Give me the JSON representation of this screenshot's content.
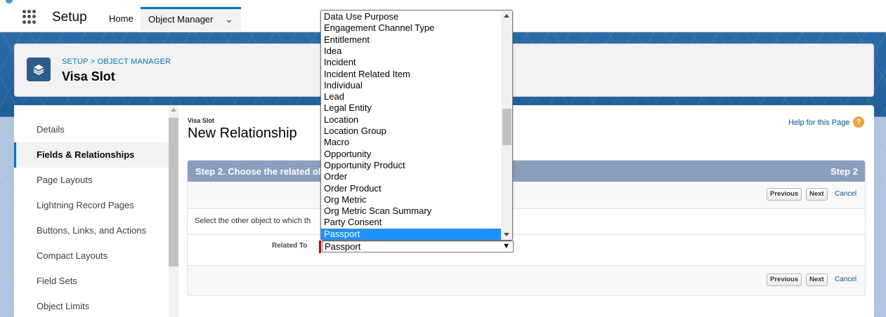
{
  "topnav": {
    "app_name": "Setup",
    "home": "Home",
    "object_manager": "Object Manager",
    "chevron": "⌄"
  },
  "header": {
    "breadcrumb": "SETUP > OBJECT MANAGER",
    "title": "Visa Slot",
    "icon": "layers-icon"
  },
  "sidebar": {
    "items": [
      {
        "label": "Details"
      },
      {
        "label": "Fields & Relationships"
      },
      {
        "label": "Page Layouts"
      },
      {
        "label": "Lightning Record Pages"
      },
      {
        "label": "Buttons, Links, and Actions"
      },
      {
        "label": "Compact Layouts"
      },
      {
        "label": "Field Sets"
      },
      {
        "label": "Object Limits"
      }
    ],
    "active_index": 1
  },
  "content": {
    "object_label": "Visa Slot",
    "title": "New Relationship",
    "help_link": "Help for this Page",
    "help_icon": "?",
    "step_title": "Step 2. Choose the related ob",
    "step_number": "Step 2",
    "previous": "Previous",
    "next": "Next",
    "cancel": "Cancel",
    "instruction": "Select the other object to which th",
    "related_to_label": "Related To",
    "related_to_value": "Passport"
  },
  "dropdown": {
    "options": [
      "Data Use Purpose",
      "Engagement Channel Type",
      "Entitlement",
      "Idea",
      "Incident",
      "Incident Related Item",
      "Individual",
      "Lead",
      "Legal Entity",
      "Location",
      "Location Group",
      "Macro",
      "Opportunity",
      "Opportunity Product",
      "Order",
      "Order Product",
      "Org Metric",
      "Org Metric Scan Summary",
      "Party Consent",
      "Passport"
    ],
    "selected": "Passport"
  },
  "colors": {
    "accent": "#0176d3",
    "step_header": "#8a9ebe",
    "selected_option": "#1e90ff",
    "required": "#cc0000"
  }
}
